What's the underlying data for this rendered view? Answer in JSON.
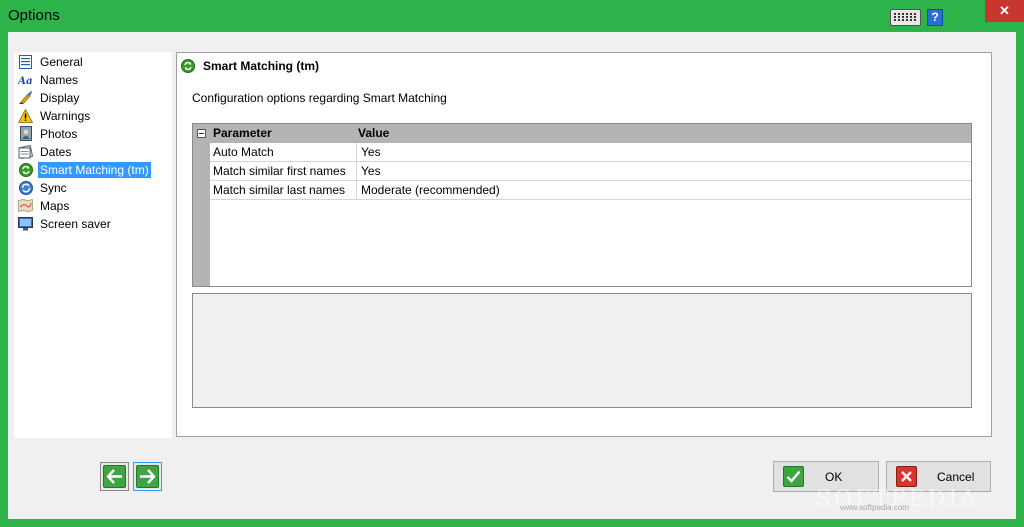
{
  "window": {
    "title": "Options",
    "help_label": "?",
    "close_label": "✕"
  },
  "sidebar": {
    "items": [
      {
        "label": "General",
        "icon": "document-icon"
      },
      {
        "label": "Names",
        "icon": "font-aa-icon"
      },
      {
        "label": "Display",
        "icon": "brush-icon"
      },
      {
        "label": "Warnings",
        "icon": "warning-icon"
      },
      {
        "label": "Photos",
        "icon": "photo-frame-icon"
      },
      {
        "label": "Dates",
        "icon": "calendar-icon"
      },
      {
        "label": "Smart Matching (tm)",
        "icon": "smart-matching-icon",
        "selected": true
      },
      {
        "label": "Sync",
        "icon": "sync-icon"
      },
      {
        "label": "Maps",
        "icon": "map-icon"
      },
      {
        "label": "Screen saver",
        "icon": "monitor-icon"
      }
    ]
  },
  "main": {
    "title": "Smart Matching (tm)",
    "description": "Configuration options regarding Smart Matching",
    "grid": {
      "columns": [
        "Parameter",
        "Value"
      ],
      "rows": [
        [
          "Auto Match",
          "Yes"
        ],
        [
          "Match similar first names",
          "Yes"
        ],
        [
          "Match similar last names",
          "Moderate (recommended)"
        ]
      ]
    }
  },
  "buttons": {
    "ok_label": "OK",
    "cancel_label": "Cancel"
  },
  "watermark": {
    "text": "SOFTPEDIA",
    "sub": "www.softpedia.com"
  },
  "colors": {
    "window_frame": "#2cb34a",
    "selection": "#3399ff",
    "close": "#c7372f"
  }
}
